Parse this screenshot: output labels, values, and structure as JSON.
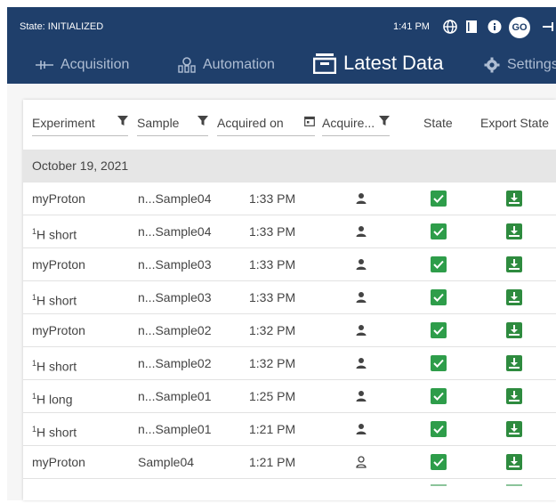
{
  "status": {
    "state_text": "State: INITIALIZED",
    "time": "1:41 PM",
    "avatar_initials": "GO"
  },
  "nav": {
    "tabs": [
      {
        "label": "Acquisition",
        "icon": "acquisition-icon"
      },
      {
        "label": "Automation",
        "icon": "automation-icon"
      },
      {
        "label": "Latest Data",
        "icon": "latest-data-icon",
        "active": true
      },
      {
        "label": "Settings",
        "icon": "gear-icon"
      }
    ]
  },
  "table": {
    "headers": {
      "experiment": "Experiment",
      "sample": "Sample",
      "acquired_on": "Acquired on",
      "acquired_by": "Acquire...",
      "state": "State",
      "export_state": "Export State"
    },
    "group_label": "October 19, 2021",
    "rows": [
      {
        "exp_pre": "",
        "exp_sup": "",
        "exp": "myProton",
        "sample": "n...Sample04",
        "time": "1:33 PM",
        "user": "filled"
      },
      {
        "exp_pre": "",
        "exp_sup": "1",
        "exp": "H short",
        "sample": "n...Sample04",
        "time": "1:33 PM",
        "user": "filled"
      },
      {
        "exp_pre": "",
        "exp_sup": "",
        "exp": "myProton",
        "sample": "n...Sample03",
        "time": "1:33 PM",
        "user": "filled"
      },
      {
        "exp_pre": "",
        "exp_sup": "1",
        "exp": "H short",
        "sample": "n...Sample03",
        "time": "1:33 PM",
        "user": "filled"
      },
      {
        "exp_pre": "",
        "exp_sup": "",
        "exp": "myProton",
        "sample": "n...Sample02",
        "time": "1:32 PM",
        "user": "filled"
      },
      {
        "exp_pre": "",
        "exp_sup": "1",
        "exp": "H short",
        "sample": "n...Sample02",
        "time": "1:32 PM",
        "user": "filled"
      },
      {
        "exp_pre": "",
        "exp_sup": "1",
        "exp": "H long",
        "sample": "n...Sample01",
        "time": "1:25 PM",
        "user": "filled"
      },
      {
        "exp_pre": "",
        "exp_sup": "1",
        "exp": "H short",
        "sample": "n...Sample01",
        "time": "1:21 PM",
        "user": "filled"
      },
      {
        "exp_pre": "",
        "exp_sup": "",
        "exp": "myProton",
        "sample": "Sample04",
        "time": "1:21 PM",
        "user": "outline"
      }
    ]
  },
  "colors": {
    "header_bg": "#1f3f6b",
    "state_green": "#2e9d4a",
    "export_green": "#2e8b3f"
  }
}
